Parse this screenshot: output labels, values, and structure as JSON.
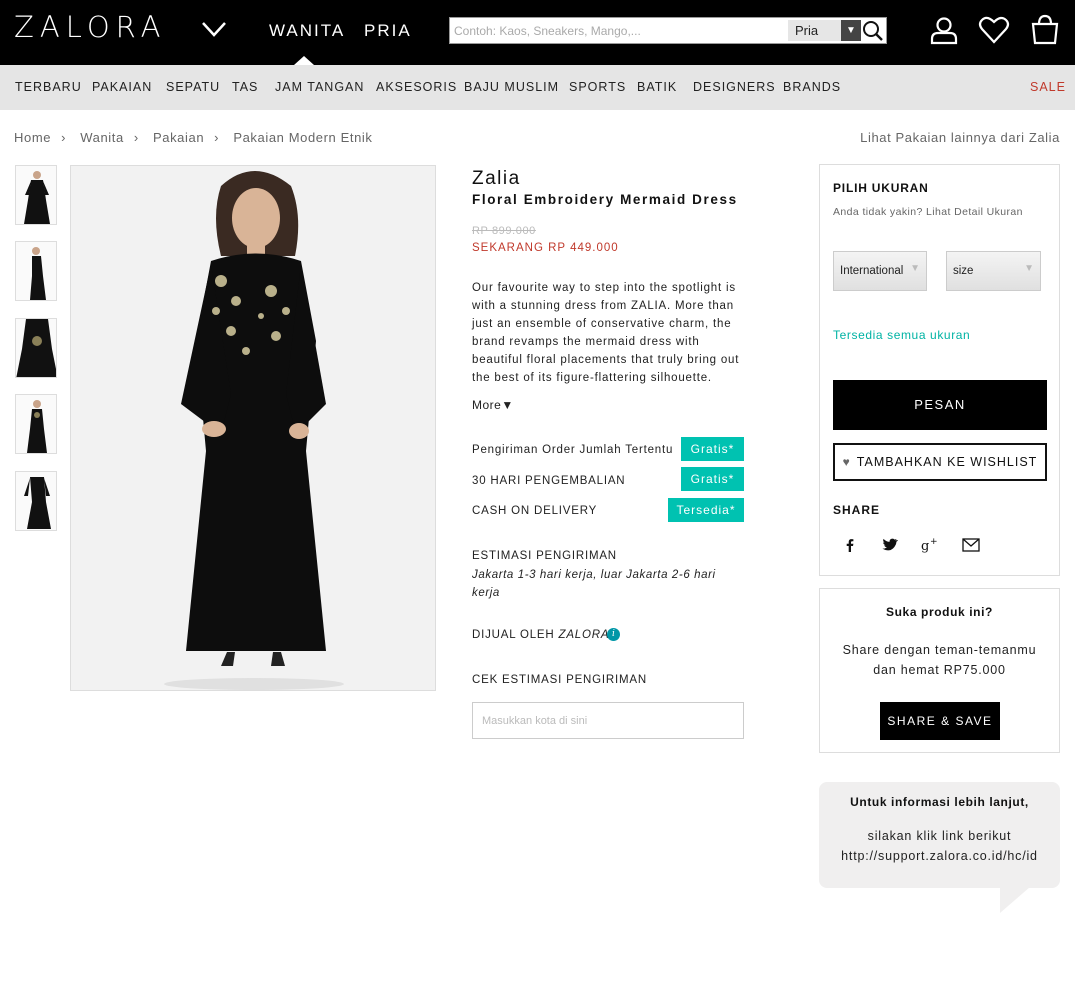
{
  "header": {
    "logo": "ZALORA",
    "genders": [
      "WANITA",
      "PRIA"
    ],
    "search": {
      "placeholder": "Contoh: Kaos, Sneakers, Mango,...",
      "category": "Pria"
    },
    "icons": [
      "account-icon",
      "wishlist-heart-icon",
      "shopping-bag-icon"
    ]
  },
  "nav": {
    "items": [
      "TERBARU",
      "PAKAIAN",
      "SEPATU",
      "TAS",
      "JAM TANGAN",
      "AKSESORIS",
      "BAJU MUSLIM",
      "SPORTS",
      "BATIK",
      "DESIGNERS",
      "BRANDS"
    ],
    "sale": "SALE"
  },
  "breadcrumb": [
    "Home",
    "Wanita",
    "Pakaian",
    "Pakaian Modern Etnik"
  ],
  "more_link": "Lihat Pakaian lainnya dari Zalia",
  "product": {
    "brand": "Zalia",
    "name": "Floral Embroidery Mermaid Dress",
    "old_price": "RP 899.000",
    "new_price": "SEKARANG RP 449.000",
    "description": "Our favourite way to step into the spotlight is with a stunning dress from ZALIA. More than just an ensemble of conservative charm, the brand revamps the mermaid dress with beautiful floral placements that truly bring out the best of its figure-flattering silhouette.",
    "more": "More▼",
    "benefits": [
      {
        "label": "Pengiriman Order Jumlah Tertentu",
        "badge": "Gratis*"
      },
      {
        "label": "30 HARI PENGEMBALIAN",
        "badge": "Gratis*"
      },
      {
        "label": "CASH ON DELIVERY",
        "badge": "Tersedia*"
      }
    ],
    "estimate_title": "ESTIMASI PENGIRIMAN",
    "estimate_text": "Jakarta 1-3 hari kerja, luar Jakarta 2-6 hari kerja",
    "sold_by_label": "DIJUAL OLEH",
    "sold_by": "ZALORA",
    "check_title": "CEK ESTIMASI PENGIRIMAN",
    "check_placeholder": "Masukkan kota di sini"
  },
  "size_panel": {
    "title": "PILIH UKURAN",
    "subtitle": "Anda tidak yakin?  Lihat Detail Ukuran",
    "system": "International",
    "size": "size",
    "availability": "Tersedia semua ukuran",
    "order": "PESAN",
    "wishlist": "TAMBAHKAN KE WISHLIST",
    "share": "SHARE",
    "social": [
      "facebook-icon",
      "twitter-icon",
      "google-plus-icon",
      "email-icon"
    ]
  },
  "promo": {
    "title": "Suka produk ini?",
    "text_1": "Share dengan teman-temanmu",
    "text_2": "dan hemat RP75.000",
    "button": "SHARE & SAVE"
  },
  "info": {
    "title": "Untuk informasi lebih lanjut,",
    "text_1": "silakan klik link berikut",
    "text_2": "http://support.zalora.co.id/hc/id"
  },
  "colors": {
    "accent": "#00c2b1",
    "price": "#c0392b",
    "header": "#000000",
    "nav": "#e5e5e5"
  }
}
